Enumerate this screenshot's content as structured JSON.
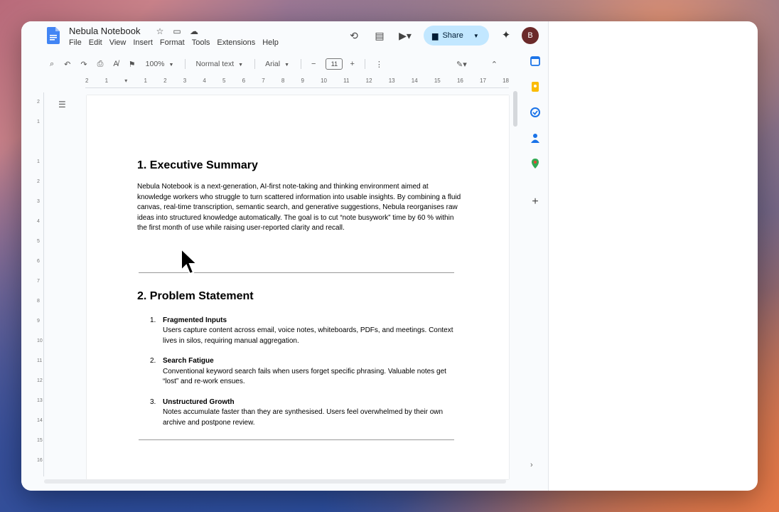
{
  "header": {
    "title": "Nebula Notebook",
    "menu": [
      "File",
      "Edit",
      "View",
      "Insert",
      "Format",
      "Tools",
      "Extensions",
      "Help"
    ],
    "share_label": "Share",
    "avatar_initial": "B"
  },
  "toolbar": {
    "zoom": "100%",
    "style": "Normal text",
    "font": "Arial",
    "font_size": "11"
  },
  "ruler": {
    "labels": [
      "2",
      "1",
      "",
      "1",
      "2",
      "3",
      "4",
      "5",
      "6",
      "7",
      "8",
      "9",
      "10",
      "11",
      "12",
      "13",
      "14",
      "15",
      "16",
      "17",
      "18"
    ],
    "vlabels": [
      "2",
      "1",
      "",
      "1",
      "2",
      "3",
      "4",
      "5",
      "6",
      "7",
      "8",
      "9",
      "10",
      "11",
      "12",
      "13",
      "14",
      "15",
      "16"
    ]
  },
  "doc": {
    "section1_title": "1. Executive Summary",
    "section1_body": "Nebula Notebook is a next-generation, AI-first note-taking and thinking environment aimed at knowledge workers who struggle to turn scattered information into usable insights. By combining a fluid canvas, real-time transcription, semantic search, and generative suggestions, Nebula reorganises raw ideas into structured knowledge automatically. The goal is to cut “note busywork” time by 60 % within the first month of use while raising user-reported clarity and recall.",
    "section2_title": "2. Problem Statement",
    "problems": [
      {
        "num": "1.",
        "label": "Fragmented Inputs",
        "text": "Users capture content across email, voice notes, whiteboards, PDFs, and meetings. Context lives in silos, requiring manual aggregation."
      },
      {
        "num": "2.",
        "label": "Search Fatigue",
        "text": "Conventional keyword search fails when users forget specific phrasing. Valuable notes get “lost” and re-work ensues."
      },
      {
        "num": "3.",
        "label": "Unstructured Growth",
        "text": "Notes accumulate faster than they are synthesised. Users feel overwhelmed by their own archive and postpone review."
      }
    ]
  },
  "colors": {
    "share_bg": "#c2e7ff",
    "avatar_bg": "#6b2a2a",
    "calendar": "#1a73e8",
    "keep": "#fbbc04",
    "tasks": "#1a73e8",
    "contacts": "#1a73e8",
    "maps": "#34a853"
  }
}
